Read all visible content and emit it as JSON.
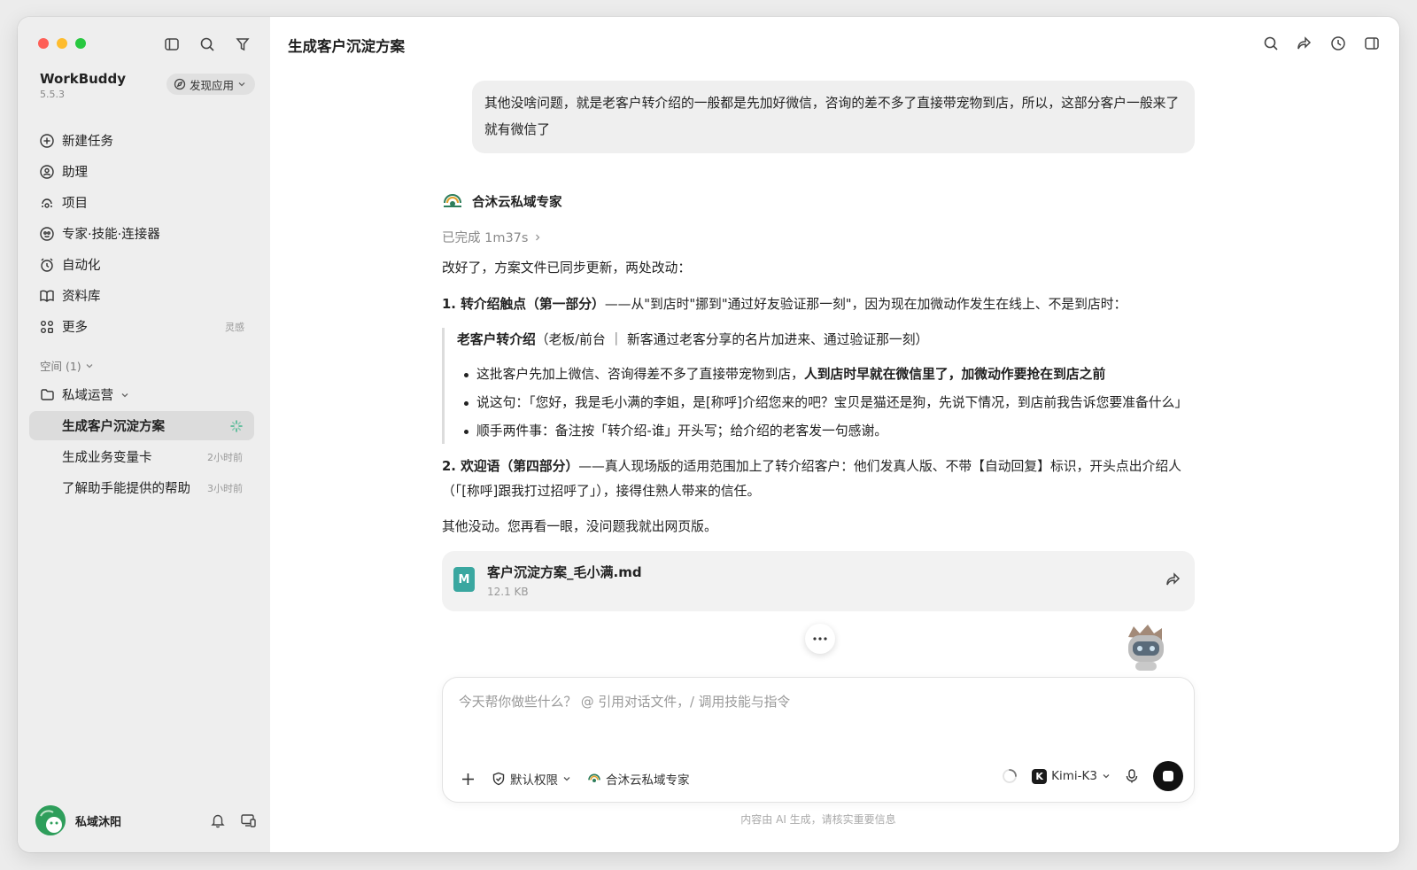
{
  "window": {
    "title": "生成客户沉淀方案"
  },
  "sidebar": {
    "brand_name": "WorkBuddy",
    "brand_version": "5.5.3",
    "discover_label": "发现应用",
    "nav": [
      {
        "label": "新建任务",
        "icon": "new-task-icon",
        "hint": ""
      },
      {
        "label": "助理",
        "icon": "assistant-icon",
        "hint": ""
      },
      {
        "label": "项目",
        "icon": "project-icon",
        "hint": ""
      },
      {
        "label": "专家·技能·连接器",
        "icon": "expert-icon",
        "hint": ""
      },
      {
        "label": "自动化",
        "icon": "alarm-icon",
        "hint": ""
      },
      {
        "label": "资料库",
        "icon": "book-icon",
        "hint": ""
      },
      {
        "label": "更多",
        "icon": "apps-icon",
        "hint": "灵感"
      }
    ],
    "space_header": "空间 (1)",
    "folder_label": "私域运营",
    "tasks": [
      {
        "label": "生成客户沉淀方案",
        "time": "",
        "active": true
      },
      {
        "label": "生成业务变量卡",
        "time": "2小时前",
        "active": false
      },
      {
        "label": "了解助手能提供的帮助",
        "time": "3小时前",
        "active": false
      }
    ],
    "user_name": "私域沐阳"
  },
  "conversation": {
    "user_message": "其他没啥问题，就是老客户转介绍的一般都是先加好微信，咨询的差不多了直接带宠物到店，所以，这部分客户一般来了就有微信了",
    "agent_name": "合沐云私域专家",
    "status": "已完成 1m37s",
    "intro": "改好了，方案文件已同步更新，两处改动：",
    "change1_bold": "1. 转介绍触点（第一部分）",
    "change1_rest": "——从\"到店时\"挪到\"通过好友验证那一刻\"，因为现在加微动作发生在线上、不是到店时：",
    "quote_title_bold": "老客户转介绍",
    "quote_title_rest": "（老板/前台 ｜ 新客通过老客分享的名片加进来、通过验证那一刻）",
    "bullet1_plain": "这批客户先加上微信、咨询得差不多了直接带宠物到店，",
    "bullet1_bold": "人到店时早就在微信里了，加微动作要抢在到店之前",
    "bullet2": "说这句：「您好，我是毛小满的李姐，是[称呼]介绍您来的吧？宝贝是猫还是狗，先说下情况，到店前我告诉您要准备什么」",
    "bullet3": "顺手两件事：备注按「转介绍-谁」开头写；给介绍的老客发一句感谢。",
    "change2_bold": "2. 欢迎语（第四部分）",
    "change2_rest": "——真人现场版的适用范围加上了转介绍客户：他们发真人版、不带【自动回复】标识，开头点出介绍人（「[称呼]跟我打过招呼了」），接得住熟人带来的信任。",
    "closing": "其他没动。您再看一眼，没问题我就出网页版。",
    "file": {
      "name": "客户沉淀方案_毛小满.md",
      "size": "12.1 KB",
      "icon_letter": "M"
    }
  },
  "composer": {
    "placeholder": "今天帮你做些什么？ @ 引用对话文件，/ 调用技能与指令",
    "permission_label": "默认权限",
    "agent_label": "合沐云私域专家",
    "model_label": "Kimi-K3",
    "model_letter": "K"
  },
  "disclaimer": "内容由 AI 生成，请核实重要信息",
  "colors": {
    "sidebar_bg": "#eeeeee",
    "accent_green": "#2e9e5b",
    "file_icon": "#3aa7a0"
  }
}
